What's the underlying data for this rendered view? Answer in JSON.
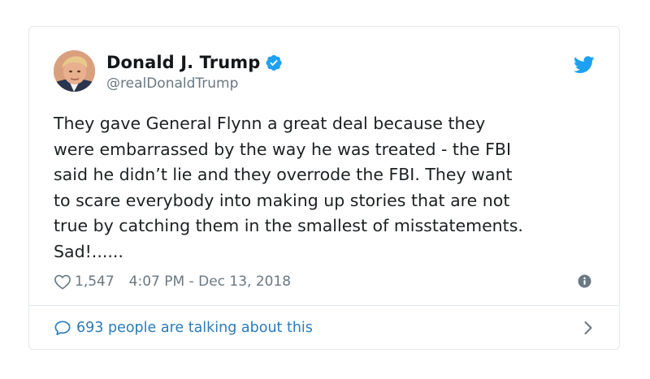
{
  "tweet": {
    "author": {
      "display_name": "Donald J. Trump",
      "handle": "@realDonaldTrump",
      "verified": true
    },
    "text": "They gave General Flynn a great deal because they\nwere embarrassed by the way he was treated - the FBI\nsaid he didn’t lie and they overrode the FBI. They want\nto scare everybody into making up stories that are not\ntrue by catching them in the smallest of misstatements.\nSad!......",
    "like_count": "1,547",
    "timestamp": "4:07 PM - Dec 13, 2018",
    "talking_text": "693 people are talking about this"
  },
  "icons": {
    "brand": "twitter-bird-icon",
    "verified": "verified-badge-icon",
    "like": "heart-icon",
    "info": "info-icon",
    "reply": "speech-bubble-icon",
    "more": "chevron-right-icon"
  },
  "colors": {
    "twitter_blue": "#1da1f2",
    "link_blue": "#2b7bb9",
    "text_primary": "#1c2022",
    "text_secondary": "#697882",
    "border": "#e1e8ed"
  }
}
